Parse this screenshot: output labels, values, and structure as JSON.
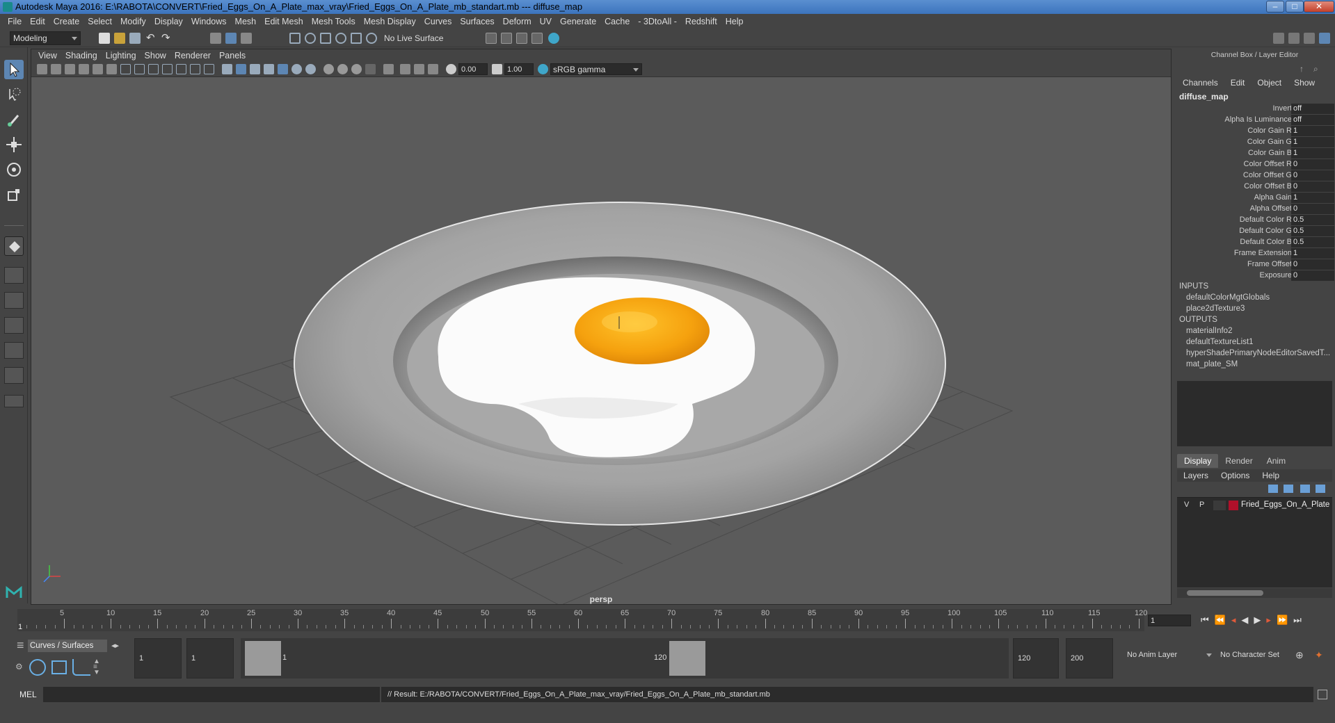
{
  "window": {
    "title": "Autodesk Maya 2016: E:\\RABOTA\\CONVERT\\Fried_Eggs_On_A_Plate_max_vray\\Fried_Eggs_On_A_Plate_mb_standart.mb  ---  diffuse_map",
    "minimize": "–",
    "maximize": "□",
    "close": "✕"
  },
  "menubar": [
    "File",
    "Edit",
    "Create",
    "Select",
    "Modify",
    "Display",
    "Windows",
    "Mesh",
    "Edit Mesh",
    "Mesh Tools",
    "Mesh Display",
    "Curves",
    "Surfaces",
    "Deform",
    "UV",
    "Generate",
    "Cache",
    "- 3DtoAll -",
    "Redshift",
    "Help"
  ],
  "statusline": {
    "mode": "Modeling",
    "live_surface": "No Live Surface"
  },
  "viewport": {
    "menu": [
      "View",
      "Shading",
      "Lighting",
      "Show",
      "Renderer",
      "Panels"
    ],
    "exposure": "0.00",
    "gamma": "1.00",
    "color_space": "sRGB gamma",
    "camera_label": "persp"
  },
  "channel_box": {
    "title": "Channel Box / Layer Editor",
    "menu": [
      "Channels",
      "Edit",
      "Object",
      "Show"
    ],
    "node": "diffuse_map",
    "attributes": [
      {
        "label": "Invert",
        "value": "off"
      },
      {
        "label": "Alpha Is Luminance",
        "value": "off"
      },
      {
        "label": "Color Gain R",
        "value": "1"
      },
      {
        "label": "Color Gain G",
        "value": "1"
      },
      {
        "label": "Color Gain B",
        "value": "1"
      },
      {
        "label": "Color Offset R",
        "value": "0"
      },
      {
        "label": "Color Offset G",
        "value": "0"
      },
      {
        "label": "Color Offset B",
        "value": "0"
      },
      {
        "label": "Alpha Gain",
        "value": "1"
      },
      {
        "label": "Alpha Offset",
        "value": "0"
      },
      {
        "label": "Default Color R",
        "value": "0.5"
      },
      {
        "label": "Default Color G",
        "value": "0.5"
      },
      {
        "label": "Default Color B",
        "value": "0.5"
      },
      {
        "label": "Frame Extension",
        "value": "1"
      },
      {
        "label": "Frame Offset",
        "value": "0"
      },
      {
        "label": "Exposure",
        "value": "0"
      }
    ],
    "inputs_header": "INPUTS",
    "inputs": [
      "defaultColorMgtGlobals",
      "place2dTexture3"
    ],
    "outputs_header": "OUTPUTS",
    "outputs": [
      "materialInfo2",
      "defaultTextureList1",
      "hyperShadePrimaryNodeEditorSavedT...",
      "mat_plate_SM"
    ]
  },
  "layer_editor": {
    "tabs": [
      "Display",
      "Render",
      "Anim"
    ],
    "menu": [
      "Layers",
      "Options",
      "Help"
    ],
    "layers": [
      {
        "v": "V",
        "p": "P",
        "color": "#b0102a",
        "name": "Fried_Eggs_On_A_Plate"
      }
    ]
  },
  "timeline": {
    "ticks": [
      "5",
      "10",
      "15",
      "20",
      "25",
      "30",
      "35",
      "40",
      "45",
      "50",
      "55",
      "60",
      "65",
      "70",
      "75",
      "80",
      "85",
      "90",
      "95",
      "100",
      "105",
      "110",
      "115",
      "120"
    ],
    "start_label": "1",
    "current_frame": "1"
  },
  "range": {
    "shelf_tab": "Curves / Surfaces",
    "start": "1",
    "playback_start": "1",
    "range_start": "1",
    "range_end": "120",
    "playback_end": "120",
    "end": "200",
    "anim_layer": "No Anim Layer",
    "character_set": "No Character Set"
  },
  "command_line": {
    "mode": "MEL",
    "result": "// Result: E:/RABOTA/CONVERT/Fried_Eggs_On_A_Plate_max_vray/Fried_Eggs_On_A_Plate_mb_standart.mb"
  }
}
